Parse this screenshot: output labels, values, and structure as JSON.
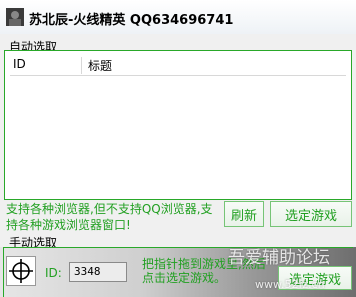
{
  "window": {
    "title": "苏北辰-火线精英 QQ634696741",
    "icon": "app-avatar-icon"
  },
  "auto_select": {
    "label": "自动选取",
    "columns": [
      "ID",
      "标题"
    ],
    "rows": [],
    "hint": "支持各种浏览器,但不支持QQ浏览器,支持各种游戏浏览器窗口!",
    "refresh_label": "刷新",
    "select_label": "选定游戏"
  },
  "manual_select": {
    "label": "手动选取",
    "crosshair_icon": "crosshair-icon",
    "id_label": "ID:",
    "id_value": "3348",
    "drag_hint": "把指针拖到游戏里,然后点击选定游戏。",
    "select_label": "选定游戏"
  },
  "watermark": {
    "text": "吾爱辅助论坛",
    "url": "www.52fz.cn"
  },
  "colors": {
    "accent": "#22a022",
    "border": "#29a829"
  }
}
